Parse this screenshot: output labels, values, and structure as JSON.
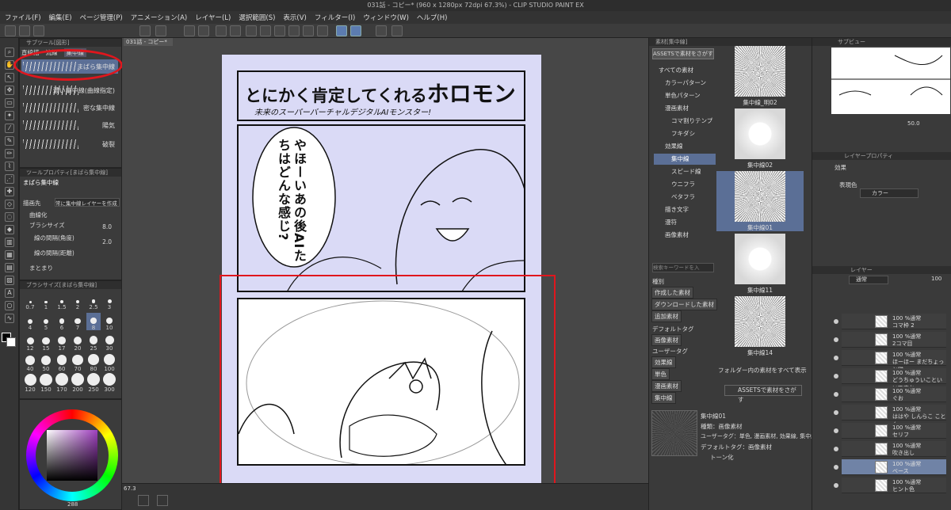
{
  "window": {
    "title": "031話 - コピー* (960 x 1280px 72dpi 67.3%) - CLIP STUDIO PAINT EX"
  },
  "menu": [
    "ファイル(F)",
    "編集(E)",
    "ページ管理(P)",
    "アニメーション(A)",
    "レイヤー(L)",
    "選択範囲(S)",
    "表示(V)",
    "フィルター(I)",
    "ウィンドウ(W)",
    "ヘルプ(H)"
  ],
  "subtool": {
    "header": "サブツール[図形]",
    "tabs": [
      "直線描",
      "流線",
      "集中線"
    ],
    "items": [
      "まばら集中線",
      "濃い集中線(曲線指定)",
      "密な集中線",
      "陽気",
      "破裂"
    ]
  },
  "toolprops": {
    "header": "ツールプロパティ[まばら集中線]",
    "name": "まばら集中線",
    "draw_target_label": "描画先",
    "draw_target_value": "常に集中線レイヤーを作成",
    "curve": "曲線化",
    "brush_size_label": "ブラシサイズ",
    "brush_size_value": "8.0",
    "interval_angle_label": "線の間隔(角度)",
    "interval_angle_value": "2.0",
    "interval_distance_label": "線の間隔(距離)",
    "grouping": "まとまり"
  },
  "brushsize": {
    "header": "ブラシサイズ[まばら集中線]",
    "sizes": [
      "0.7",
      "1",
      "1.5",
      "2",
      "2.5",
      "3",
      "4",
      "5",
      "6",
      "7",
      "8",
      "10",
      "12",
      "15",
      "17",
      "20",
      "25",
      "30",
      "40",
      "50",
      "60",
      "70",
      "80",
      "100",
      "120",
      "150",
      "170",
      "200",
      "250",
      "300"
    ],
    "selected": "8"
  },
  "color": {
    "footer": "288"
  },
  "canvas": {
    "tab": "031話 - コピー*",
    "zoom": "67.3",
    "title_main": "とにかく肯定してくれる",
    "title_accent": "ホロモン",
    "subtitle": "未来のスーパーバーチャルデジタルAIモンスター!",
    "bubble": "やほーいあの後AIたちはどんな感じ?"
  },
  "materials": {
    "header": "素材[集中線]",
    "assets_button": "ASSETSで素材をさがす",
    "tree": [
      {
        "label": "すべての素材",
        "sel": false
      },
      {
        "label": "カラーパターン",
        "sel": false
      },
      {
        "label": "単色パターン",
        "sel": false
      },
      {
        "label": "漫画素材",
        "sel": false
      },
      {
        "label": "コマ割りテンプ",
        "sel": false
      },
      {
        "label": "フキダシ",
        "sel": false
      },
      {
        "label": "効果線",
        "sel": false
      },
      {
        "label": "集中線",
        "sel": true
      },
      {
        "label": "スピード線",
        "sel": false
      },
      {
        "label": "ウニフラ",
        "sel": false
      },
      {
        "label": "ベタフラ",
        "sel": false
      },
      {
        "label": "描き文字",
        "sel": false
      },
      {
        "label": "漫符",
        "sel": false
      },
      {
        "label": "画像素材",
        "sel": false
      }
    ],
    "search_placeholder": "検索キーワードを入",
    "kind_label": "種別",
    "kind": [
      "作成した素材",
      "ダウンロードした素材",
      "追加素材"
    ],
    "default_tag_label": "デフォルトタグ",
    "default_tag": [
      "画像素材"
    ],
    "user_tag_label": "ユーザータグ",
    "user_tag": [
      "効果線",
      "単色",
      "漫画素材",
      "集中線"
    ],
    "thumbs": [
      "集中線_明02",
      "集中線02",
      "集中線01",
      "集中線11",
      "集中線14"
    ],
    "show_all": "フォルダー内の素材をすべて表示",
    "assets_bottom": "ASSETSで素材をさがす",
    "detail": {
      "name": "集中線01",
      "kind": "種類：画像素材",
      "user_tag": "ユーザータグ：単色, 漫画素材, 効果線, 集中線",
      "default_tag": "デフォルトタグ：画像素材",
      "tone": "トーン化"
    }
  },
  "navigator": {
    "header": "サブビュー",
    "value": "50.0"
  },
  "layer_props": {
    "header": "レイヤープロパティ",
    "effect": "効果",
    "display_color_label": "表現色",
    "display_color": "カラー"
  },
  "layers": {
    "header": "レイヤー",
    "blend": "通常",
    "opacity": "100",
    "items": [
      {
        "mode": "100 %通常",
        "name": "コマ枠 2"
      },
      {
        "mode": "100 %通常",
        "name": "2コマ目"
      },
      {
        "mode": "100 %通常",
        "name": "ほーほー まだちょっと微"
      },
      {
        "mode": "100 %通常",
        "name": "どうちゅういこといいですか"
      },
      {
        "mode": "100 %通常",
        "name": "ぐお"
      },
      {
        "mode": "100 %通常",
        "name": "ははや しんらこ ことん"
      },
      {
        "mode": "100 %通常",
        "name": "セリフ"
      },
      {
        "mode": "100 %通常",
        "name": "吹き出し"
      },
      {
        "mode": "100 %通常",
        "name": "ベース"
      },
      {
        "mode": "100 %通常",
        "name": "ヒント色"
      }
    ]
  }
}
